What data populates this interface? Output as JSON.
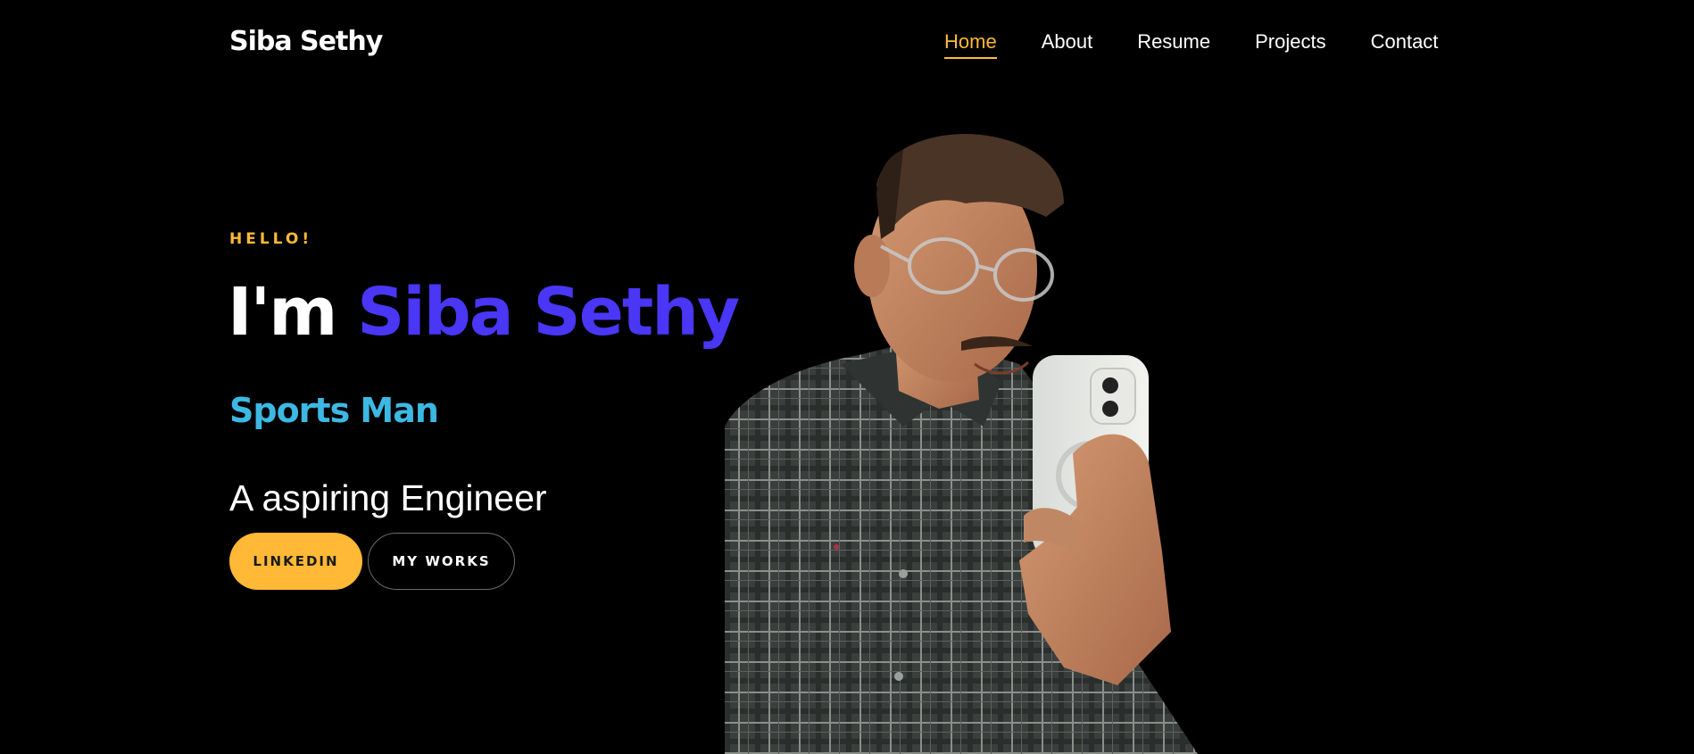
{
  "brand": "Siba Sethy",
  "nav": [
    {
      "label": "Home",
      "active": true
    },
    {
      "label": "About",
      "active": false
    },
    {
      "label": "Resume",
      "active": false
    },
    {
      "label": "Projects",
      "active": false
    },
    {
      "label": "Contact",
      "active": false
    }
  ],
  "hero": {
    "greeting": "HELLO!",
    "headline_prefix": "I'm",
    "headline_name": "Siba Sethy",
    "role": "Sports Man",
    "tagline": "A aspiring Engineer",
    "buttons": {
      "primary_label": "LINKEDIN",
      "secondary_label": "MY WORKS"
    }
  },
  "colors": {
    "background": "#000000",
    "accent": "#ffb936",
    "name": "#4a36f5",
    "role": "#3db8e3"
  }
}
